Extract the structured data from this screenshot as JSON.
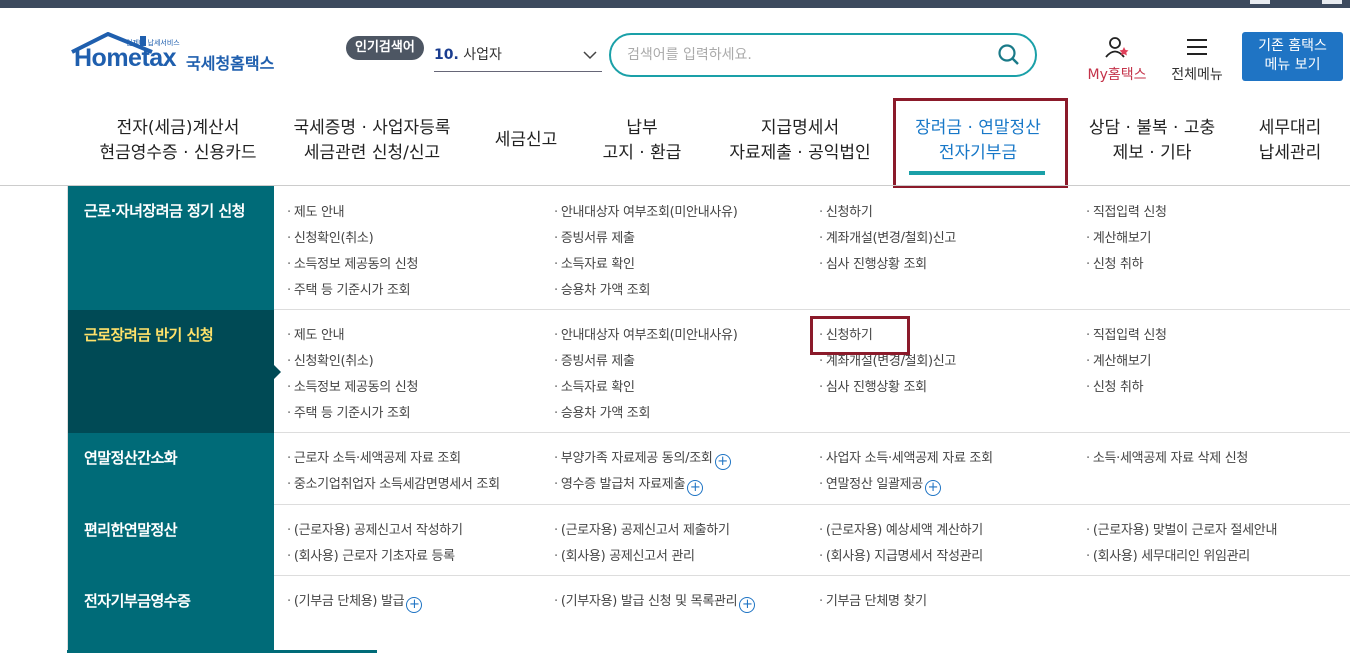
{
  "header": {
    "logo_small": "언제나 납세서비스",
    "logo_word": "Hometax",
    "logo_name": "국세청홈택스",
    "popular_badge": "인기검색어",
    "popular_rank": "10.",
    "popular_term": "사업자",
    "search_placeholder": "검색어를 입력하세요.",
    "my_label": "My홈택스",
    "all_menu_label": "전체메뉴",
    "old_menu_line1": "기존 홈택스",
    "old_menu_line2": "메뉴 보기"
  },
  "gnb": [
    {
      "line1": "전자(세금)계산서",
      "line2": "현금영수증 · 신용카드"
    },
    {
      "line1": "국세증명 · 사업자등록",
      "line2": "세금관련 신청/신고"
    },
    {
      "line1": "세금신고",
      "line2": ""
    },
    {
      "line1": "납부",
      "line2": "고지 · 환급"
    },
    {
      "line1": "지급명세서",
      "line2": "자료제출 · 공익법인"
    },
    {
      "line1": "장려금 · 연말정산",
      "line2": "전자기부금"
    },
    {
      "line1": "상담 · 불복 · 고충",
      "line2": "제보 · 기타"
    },
    {
      "line1": "세무대리",
      "line2": "납세관리"
    }
  ],
  "categories": [
    {
      "title": "근로·자녀장려금 정기 신청",
      "links": [
        "제도 안내",
        "안내대상자 여부조회(미안내사유)",
        "신청하기",
        "직접입력 신청",
        "신청확인(취소)",
        "증빙서류 제출",
        "계좌개설(변경/철회)신고",
        "계산해보기",
        "소득정보 제공동의 신청",
        "소득자료 확인",
        "심사 진행상황 조회",
        "신청 취하",
        "주택 등 기준시가 조회",
        "승용차 가액 조회"
      ]
    },
    {
      "title": "근로장려금 반기 신청",
      "links": [
        "제도 안내",
        "안내대상자 여부조회(미안내사유)",
        "신청하기",
        "직접입력 신청",
        "신청확인(취소)",
        "증빙서류 제출",
        "계좌개설(변경/철회)신고",
        "계산해보기",
        "소득정보 제공동의 신청",
        "소득자료 확인",
        "심사 진행상황 조회",
        "신청 취하",
        "주택 등 기준시가 조회",
        "승용차 가액 조회"
      ]
    },
    {
      "title": "연말정산간소화",
      "links": [
        "근로자 소득·세액공제 자료 조회",
        "부양가족 자료제공 동의/조회",
        "사업자 소득·세액공제 자료 조회",
        "소득·세액공제 자료 삭제 신청",
        "중소기업취업자 소득세감면명세서 조회",
        "영수증 발급처 자료제출",
        "연말정산 일괄제공"
      ]
    },
    {
      "title": "편리한연말정산",
      "links": [
        "(근로자용) 공제신고서 작성하기",
        "(근로자용) 공제신고서 제출하기",
        "(근로자용) 예상세액 계산하기",
        "(근로자용) 맞벌이 근로자 절세안내",
        "(회사용) 근로자 기초자료 등록",
        "(회사용) 공제신고서 관리",
        "(회사용) 지급명세서 작성관리",
        "(회사용) 세무대리인 위임관리"
      ]
    },
    {
      "title": "전자기부금영수증",
      "links": [
        "(기부금 단체용) 발급",
        "(기부자용) 발급 신청 및 목록관리",
        "기부금 단체명 찾기"
      ]
    }
  ],
  "plus_symbol": "+"
}
